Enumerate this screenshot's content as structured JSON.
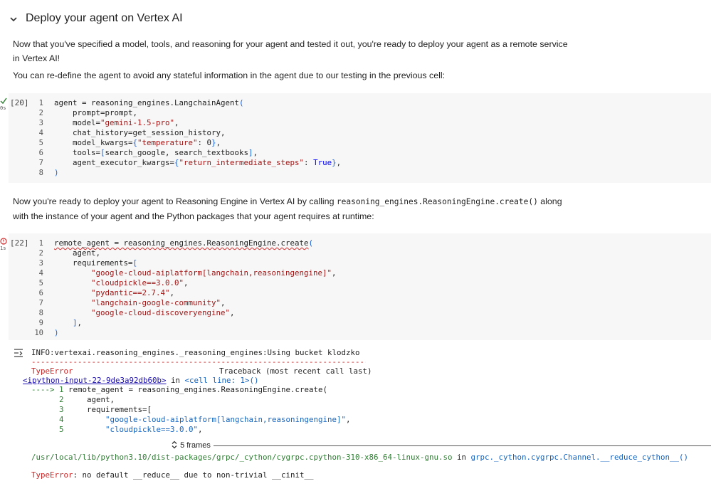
{
  "section": {
    "title": "Deploy your agent on Vertex AI",
    "chevron_icon": "chevron-down-icon"
  },
  "paragraphs": {
    "p1": "Now that you've specified a model, tools, and reasoning for your agent and tested it out, you're ready to deploy your agent as a remote service in Vertex AI!",
    "p2": "You can re-define the agent to avoid any stateful information in the agent due to our testing in the previous cell:",
    "p3_before": "Now you're ready to deploy your agent to Reasoning Engine in Vertex AI by calling",
    "p3_code": "reasoning_engines.ReasoningEngine.create()",
    "p3_after": "along",
    "p3_line2": "with the instance of your agent and the Python packages that your agent requires at runtime:"
  },
  "cell1": {
    "exec_count": "[20]",
    "status": "success",
    "time": "0s",
    "line_numbers": [
      "1",
      "2",
      "3",
      "4",
      "5",
      "6",
      "7",
      "8"
    ]
  },
  "cell2": {
    "exec_count": "[22]",
    "status": "error",
    "time": "1s",
    "line_numbers": [
      "1",
      "2",
      "3",
      "4",
      "5",
      "6",
      "7",
      "8",
      "9",
      "10"
    ]
  },
  "output": {
    "info": "INFO:vertexai.reasoning_engines._reasoning_engines:Using bucket klodzko",
    "error_type": "TypeError",
    "traceback_header": "Traceback (most recent call last)",
    "input_link": "<ipython-input-22-9de3a92db60b>",
    "in_text": " in ",
    "cell_line": "<cell line: 1>()",
    "frames_label": "5 frames",
    "so_path": "/usr/local/lib/python3.10/dist-packages/grpc/_cython/cygrpc.cpython-310-x86_64-linux-gnu.so",
    "so_func": "grpc._cython.cygrpc.Channel.__reduce_cython__()",
    "final_error": "TypeError: no default __reduce__ due to non-trivial __cinit__"
  }
}
